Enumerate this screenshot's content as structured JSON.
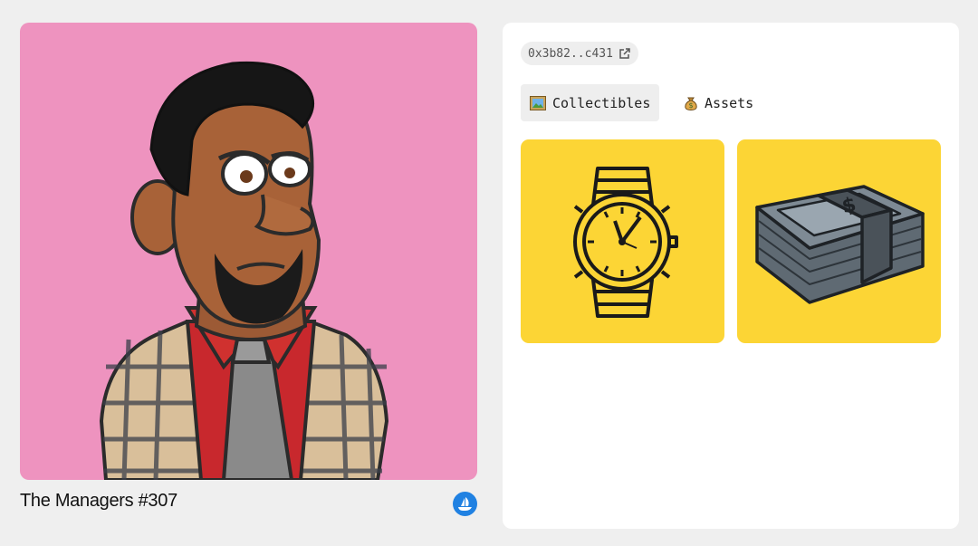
{
  "nft": {
    "title": "The Managers #307",
    "background_color": "#ee93bf",
    "marketplace_icon": "opensea-icon"
  },
  "wallet": {
    "address": "0x3b82..c431",
    "link_icon": "external-link-icon"
  },
  "tabs": [
    {
      "label": "Collectibles",
      "icon": "framed-picture-icon",
      "active": true
    },
    {
      "label": "Assets",
      "icon": "money-bag-icon",
      "active": false
    }
  ],
  "collectibles": [
    {
      "icon": "watch-icon"
    },
    {
      "icon": "cash-stack-icon"
    }
  ],
  "colors": {
    "tile_background": "#fcd535",
    "accent_blue": "#2081e2"
  }
}
